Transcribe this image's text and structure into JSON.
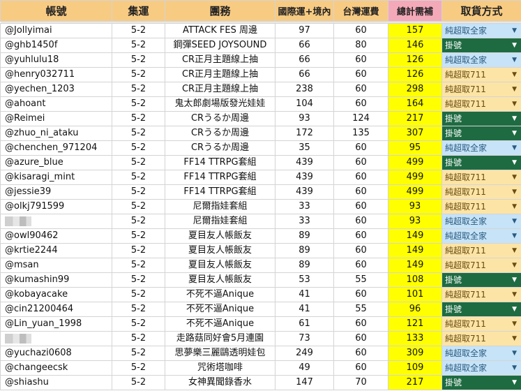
{
  "headers": {
    "account": "帳號",
    "batch": "集運",
    "group": "團務",
    "shipping_intl": "國際運+境內",
    "shipping_tw": "台灣運費",
    "total": "總計需補",
    "pickup": "取貨方式"
  },
  "colors": {
    "header_bg": "#f8cb83",
    "header_total_bg": "#f4a9b9",
    "total_col_bg": "#ffff00",
    "chip_blue": "#c6e3f7",
    "chip_yellow": "#fce4a6",
    "chip_green": "#1e6b41"
  },
  "rows": [
    {
      "account": "@Jollyimai",
      "batch": "5-2",
      "group": "ATTACK FES 周邊",
      "intl": "97",
      "tw": "60",
      "total": "157",
      "pickup": "純超取全家",
      "style": "blue"
    },
    {
      "account": "@ghb1450f",
      "batch": "5-2",
      "group": "鋼彈SEED JOYSOUND",
      "intl": "66",
      "tw": "80",
      "total": "146",
      "pickup": "掛號",
      "style": "green"
    },
    {
      "account": "@yuhlulu18",
      "batch": "5-2",
      "group": "CR正月主題線上抽",
      "intl": "66",
      "tw": "60",
      "total": "126",
      "pickup": "純超取全家",
      "style": "blue"
    },
    {
      "account": "@henry032711",
      "batch": "5-2",
      "group": "CR正月主題線上抽",
      "intl": "66",
      "tw": "60",
      "total": "126",
      "pickup": "純超取711",
      "style": "yellow"
    },
    {
      "account": "@yechen_1203",
      "batch": "5-2",
      "group": "CR正月主題線上抽",
      "intl": "238",
      "tw": "60",
      "total": "298",
      "pickup": "純超取711",
      "style": "yellow"
    },
    {
      "account": "@ahoant",
      "batch": "5-2",
      "group": "鬼太郎劇場版發光娃娃",
      "intl": "104",
      "tw": "60",
      "total": "164",
      "pickup": "純超取711",
      "style": "yellow"
    },
    {
      "account": "@Reimei",
      "batch": "5-2",
      "group": "CRうるか周邊",
      "intl": "93",
      "tw": "124",
      "total": "217",
      "pickup": "掛號",
      "style": "green"
    },
    {
      "account": "@zhuo_ni_ataku",
      "batch": "5-2",
      "group": "CRうるか周邊",
      "intl": "172",
      "tw": "135",
      "total": "307",
      "pickup": "掛號",
      "style": "green"
    },
    {
      "account": "@chenchen_971204",
      "batch": "5-2",
      "group": "CRうるか周邊",
      "intl": "35",
      "tw": "60",
      "total": "95",
      "pickup": "純超取全家",
      "style": "blue"
    },
    {
      "account": "@azure_blue",
      "batch": "5-2",
      "group": "FF14 TTRPG套組",
      "intl": "439",
      "tw": "60",
      "total": "499",
      "pickup": "掛號",
      "style": "green"
    },
    {
      "account": "@kisaragi_mint",
      "batch": "5-2",
      "group": "FF14 TTRPG套組",
      "intl": "439",
      "tw": "60",
      "total": "499",
      "pickup": "純超取711",
      "style": "yellow"
    },
    {
      "account": "@jessie39",
      "batch": "5-2",
      "group": "FF14 TTRPG套組",
      "intl": "439",
      "tw": "60",
      "total": "499",
      "pickup": "純超取711",
      "style": "yellow"
    },
    {
      "account": "@olkj791599",
      "batch": "5-2",
      "group": "尼爾指娃套組",
      "intl": "33",
      "tw": "60",
      "total": "93",
      "pickup": "純超取711",
      "style": "yellow"
    },
    {
      "account": "",
      "redacted": true,
      "batch": "5-2",
      "group": "尼爾指娃套組",
      "intl": "33",
      "tw": "60",
      "total": "93",
      "pickup": "純超取全家",
      "style": "blue"
    },
    {
      "account": "@owl90462",
      "batch": "5-2",
      "group": "夏目友人帳飯友",
      "intl": "89",
      "tw": "60",
      "total": "149",
      "pickup": "純超取全家",
      "style": "blue"
    },
    {
      "account": "@krtie2244",
      "batch": "5-2",
      "group": "夏目友人帳飯友",
      "intl": "89",
      "tw": "60",
      "total": "149",
      "pickup": "純超取711",
      "style": "yellow"
    },
    {
      "account": "@msan",
      "batch": "5-2",
      "group": "夏目友人帳飯友",
      "intl": "89",
      "tw": "60",
      "total": "149",
      "pickup": "純超取711",
      "style": "yellow"
    },
    {
      "account": "@kumashin99",
      "batch": "5-2",
      "group": "夏目友人帳飯友",
      "intl": "53",
      "tw": "55",
      "total": "108",
      "pickup": "掛號",
      "style": "green"
    },
    {
      "account": "@kobayacake",
      "batch": "5-2",
      "group": "不死不逼Anique",
      "intl": "41",
      "tw": "60",
      "total": "101",
      "pickup": "純超取711",
      "style": "yellow"
    },
    {
      "account": "@cin21200464",
      "batch": "5-2",
      "group": "不死不逼Anique",
      "intl": "41",
      "tw": "55",
      "total": "96",
      "pickup": "掛號",
      "style": "green"
    },
    {
      "account": "@Lin_yuan_1998",
      "batch": "5-2",
      "group": "不死不逼Anique",
      "intl": "61",
      "tw": "60",
      "total": "121",
      "pickup": "純超取711",
      "style": "yellow"
    },
    {
      "account": "",
      "redacted": true,
      "batch": "5-2",
      "group": "走路菇同好會5月連園",
      "intl": "73",
      "tw": "60",
      "total": "133",
      "pickup": "純超取711",
      "style": "yellow"
    },
    {
      "account": "@yuchazi0608",
      "batch": "5-2",
      "group": "思夢樂三麗鷗透明娃包",
      "intl": "249",
      "tw": "60",
      "total": "309",
      "pickup": "純超取全家",
      "style": "blue"
    },
    {
      "account": "@changeecsk",
      "batch": "5-2",
      "group": "咒術塔咖啡",
      "intl": "49",
      "tw": "60",
      "total": "109",
      "pickup": "純超取全家",
      "style": "blue"
    },
    {
      "account": "@shiashu",
      "batch": "5-2",
      "group": "女神異聞錄香水",
      "intl": "147",
      "tw": "70",
      "total": "217",
      "pickup": "掛號",
      "style": "green"
    }
  ]
}
